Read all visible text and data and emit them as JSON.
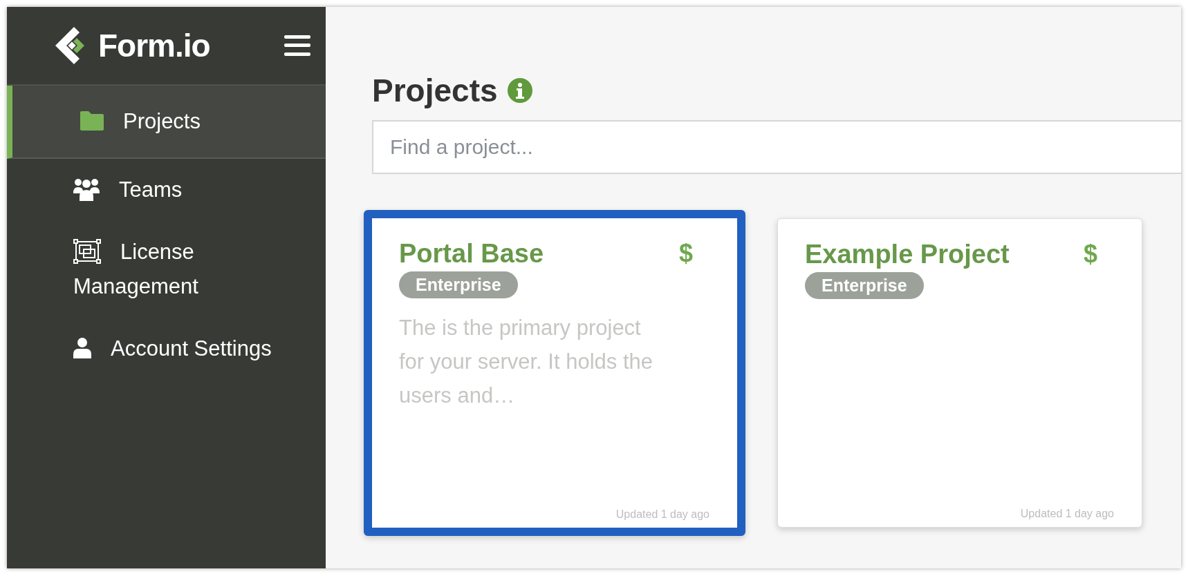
{
  "brand": {
    "name": "Form.io"
  },
  "sidebar": {
    "items": [
      {
        "label": "Projects",
        "kind": "folder",
        "selected": true
      },
      {
        "label": "Teams",
        "kind": "team",
        "selected": false
      },
      {
        "label": "License Management",
        "kind": "license",
        "selected": false
      },
      {
        "label": "Account Settings",
        "kind": "user",
        "selected": false
      }
    ]
  },
  "page": {
    "title": "Projects"
  },
  "search": {
    "placeholder": "Find a project..."
  },
  "projects": [
    {
      "title": "Portal Base",
      "price_symbol": "$",
      "plan": "Enterprise",
      "description": "The is the primary project for your server. It holds the users and…",
      "updated": "Updated 1 day ago",
      "selected": true
    },
    {
      "title": "Example Project",
      "price_symbol": "$",
      "plan": "Enterprise",
      "updated": "Updated 1 day ago",
      "selected": false
    }
  ]
}
